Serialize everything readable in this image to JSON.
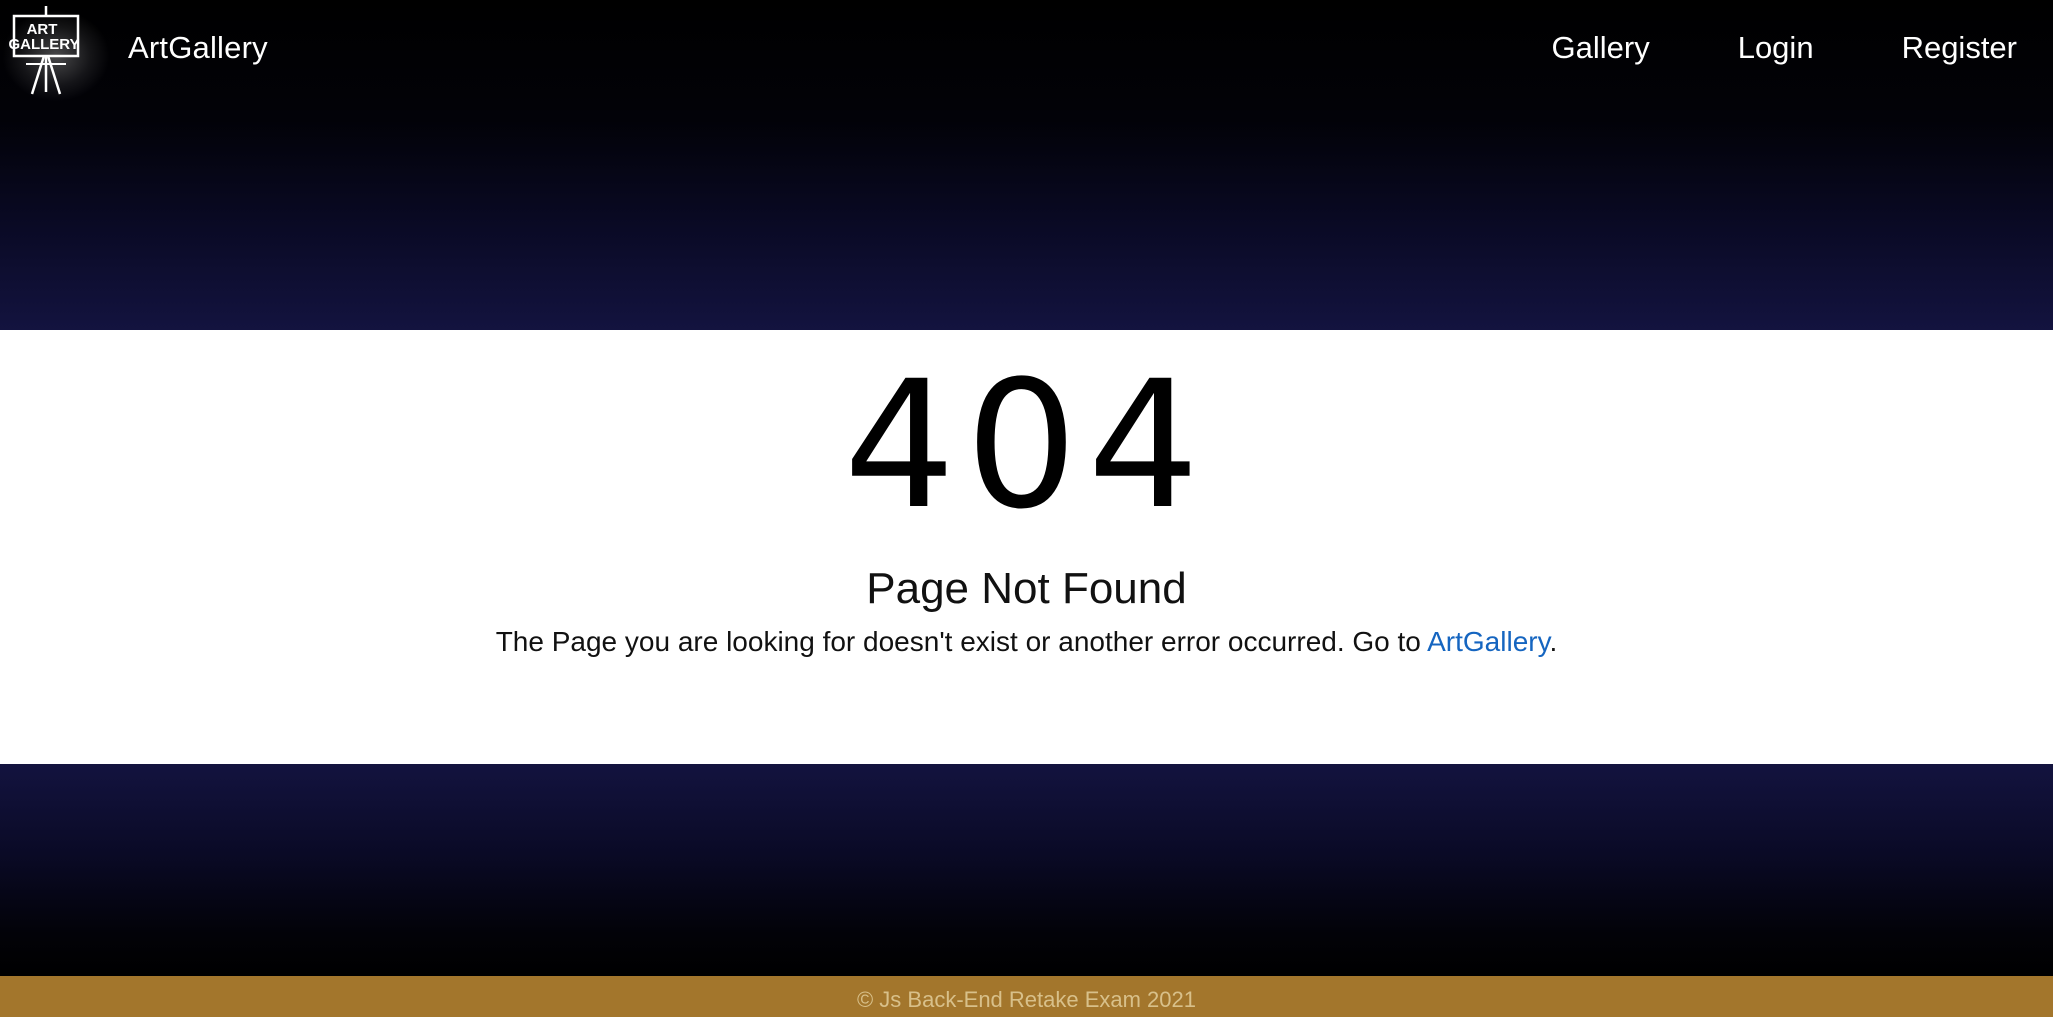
{
  "header": {
    "logo_text": "ART GALLERY",
    "brand": "ArtGallery",
    "nav": [
      {
        "label": "Gallery"
      },
      {
        "label": "Login"
      },
      {
        "label": "Register"
      }
    ]
  },
  "error": {
    "code": "404",
    "title": "Page Not Found",
    "message_prefix": "The Page you are looking for doesn't exist or another error occurred. Go to ",
    "link_label": "ArtGallery",
    "message_suffix": "."
  },
  "footer": {
    "text": "© Js Back-End Retake Exam 2021"
  },
  "colors": {
    "background": "#000000",
    "navy": "#13133f",
    "content_bg": "#ffffff",
    "link": "#1565c0",
    "footer_bg": "#a3762c",
    "footer_text": "#d8c08a"
  },
  "icons": {
    "logo": "easel-logo-icon"
  }
}
